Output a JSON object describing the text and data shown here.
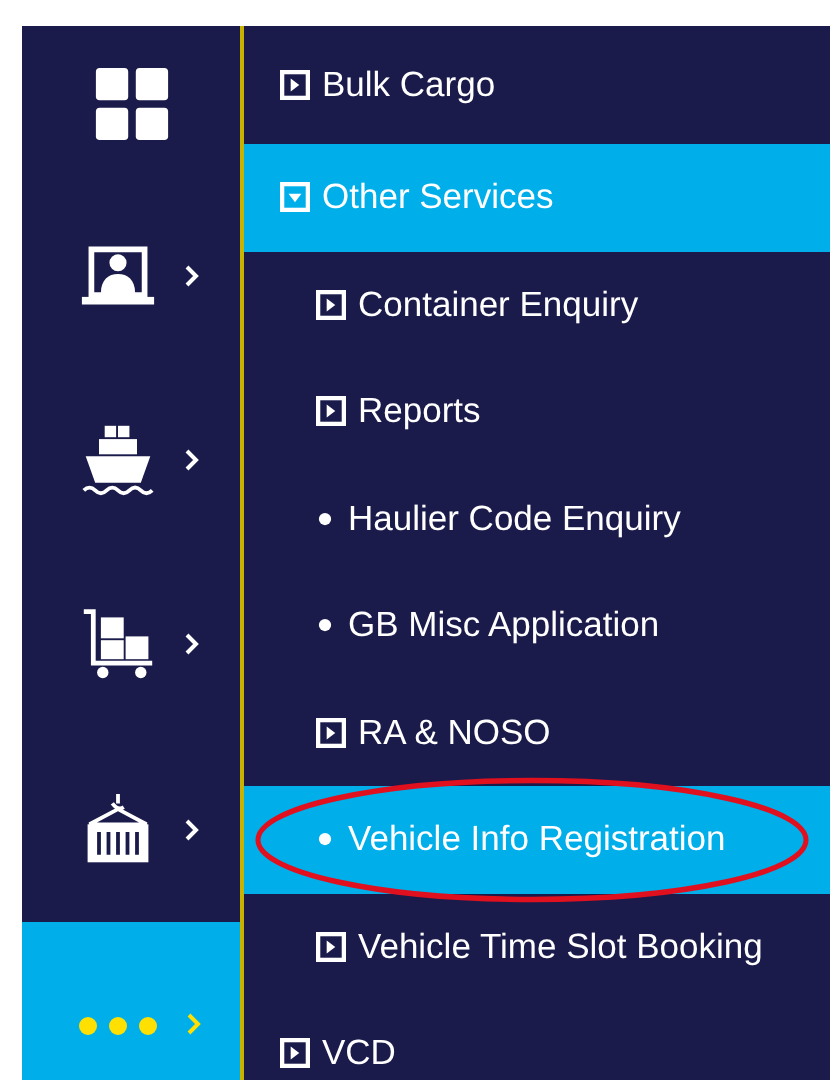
{
  "sidebar": {
    "items": [
      {
        "expandable": false,
        "selected": false
      },
      {
        "expandable": true,
        "selected": false
      },
      {
        "expandable": true,
        "selected": false
      },
      {
        "expandable": true,
        "selected": false
      },
      {
        "expandable": true,
        "selected": false
      },
      {
        "expandable": true,
        "selected": true
      }
    ]
  },
  "menu": {
    "items": [
      {
        "label": "Bulk Cargo",
        "kind": "expand",
        "selected": false,
        "circled": false
      },
      {
        "label": "Other Services",
        "kind": "collapse",
        "selected": true,
        "circled": false,
        "children": [
          {
            "label": "Container Enquiry",
            "kind": "expand",
            "selected": false,
            "circled": false
          },
          {
            "label": "Reports",
            "kind": "expand",
            "selected": false,
            "circled": false
          },
          {
            "label": "Haulier Code Enquiry",
            "kind": "bullet",
            "selected": false,
            "circled": false
          },
          {
            "label": "GB Misc Application",
            "kind": "bullet",
            "selected": false,
            "circled": false
          },
          {
            "label": "RA & NOSO",
            "kind": "expand",
            "selected": false,
            "circled": false
          },
          {
            "label": "Vehicle Info Registration",
            "kind": "bullet",
            "selected": true,
            "circled": true
          },
          {
            "label": "Vehicle Time Slot Booking",
            "kind": "expand",
            "selected": false,
            "circled": false
          }
        ]
      },
      {
        "label": "VCD",
        "kind": "expand",
        "selected": false,
        "circled": false
      }
    ]
  }
}
